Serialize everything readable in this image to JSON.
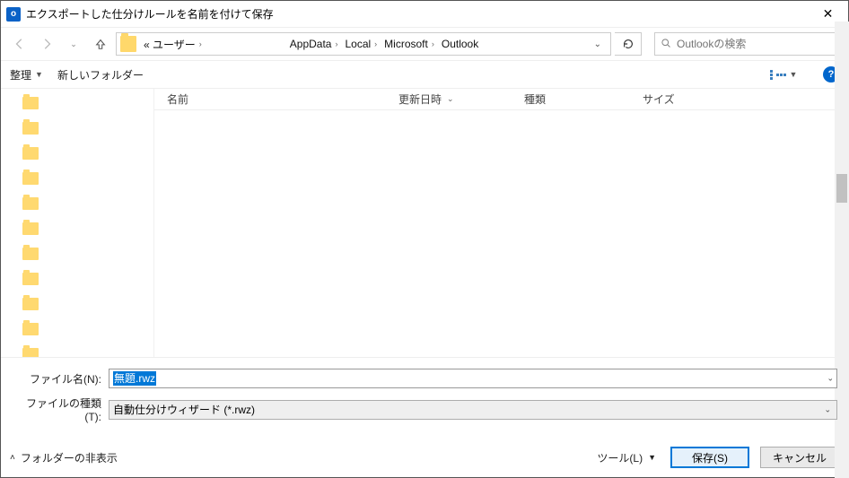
{
  "window": {
    "title": "エクスポートした仕分けルールを名前を付けて保存",
    "app_letter": "o"
  },
  "breadcrumb": {
    "prefix": "« ユーザー",
    "segments": [
      "AppData",
      "Local",
      "Microsoft",
      "Outlook"
    ]
  },
  "search": {
    "placeholder": "Outlookの検索"
  },
  "toolbar": {
    "organize": "整理",
    "new_folder": "新しいフォルダー"
  },
  "columns": {
    "name": "名前",
    "date": "更新日時",
    "type": "種類",
    "size": "サイズ"
  },
  "tree_item_count": 11,
  "fields": {
    "filename_label": "ファイル名(N):",
    "filename_value": "無題.rwz",
    "filetype_label": "ファイルの種類(T):",
    "filetype_value": "自動仕分けウィザード (*.rwz)"
  },
  "footer": {
    "hide_folders": "フォルダーの非表示",
    "tools": "ツール(L)",
    "save": "保存(S)",
    "cancel": "キャンセル"
  },
  "icons": {
    "close": "✕"
  },
  "help_glyph": "?"
}
